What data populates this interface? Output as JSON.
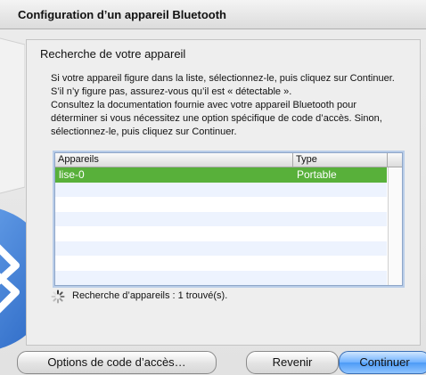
{
  "window": {
    "title": "Configuration d’un appareil Bluetooth"
  },
  "panel": {
    "heading": "Recherche de votre appareil",
    "description": [
      "Si votre appareil figure dans la liste, sélectionnez-le, puis cliquez sur Continuer. S’il n’y figure pas, assurez-vous qu’il est « détectable ».",
      "Consultez la documentation fournie avec votre appareil Bluetooth pour déterminer si vous nécessitez une option spécifique de code d’accès. Sinon, sélectionnez-le, puis cliquez sur Continuer."
    ]
  },
  "table": {
    "columns": [
      "Appareils",
      "Type"
    ],
    "rows": [
      {
        "device": "lise-0",
        "type": "Portable",
        "selected": true
      }
    ]
  },
  "status": {
    "text": "Recherche d’appareils : 1 trouvé(s)."
  },
  "buttons": {
    "options": "Options de code d’accès…",
    "back": "Revenir",
    "continue": "Continuer"
  },
  "colors": {
    "selection": "#58b03a",
    "primary_button": "#4d9bf6",
    "bluetooth_logo": "#3b7fd9"
  },
  "icons": {
    "spinner": "spinner-icon",
    "logo": "bluetooth-logo-icon"
  }
}
